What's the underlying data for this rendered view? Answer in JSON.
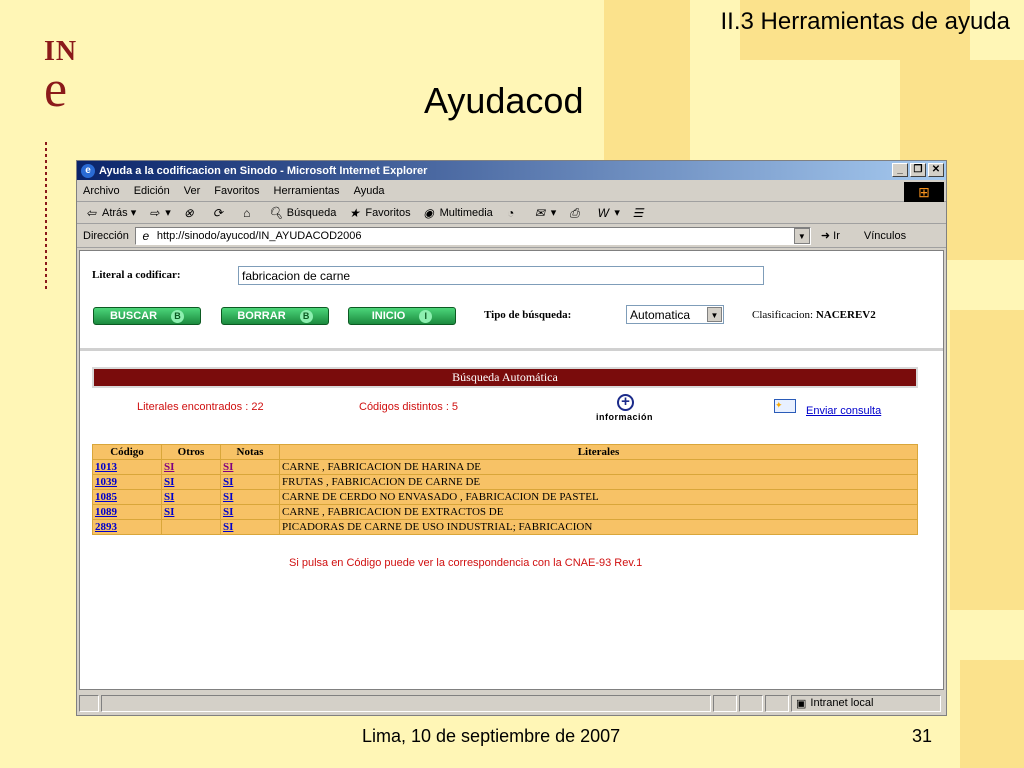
{
  "slide": {
    "header": "II.3 Herramientas de ayuda",
    "title": "Ayudacod",
    "footer_date": "Lima, 10 de septiembre de 2007",
    "page_number": "31",
    "logo_top": "IN",
    "logo_bottom": "e"
  },
  "browser": {
    "window_title": "Ayuda a la codificacion en Sinodo - Microsoft Internet Explorer",
    "menu": [
      "Archivo",
      "Edición",
      "Ver",
      "Favoritos",
      "Herramientas",
      "Ayuda"
    ],
    "toolbar": {
      "back": "Atrás",
      "search": "Búsqueda",
      "favorites": "Favoritos",
      "multimedia": "Multimedia"
    },
    "address_label": "Dirección",
    "address_url": "http://sinodo/ayucod/IN_AYUDACOD2006",
    "go_label": "Ir",
    "links_label": "Vínculos",
    "status_zone": "Intranet local"
  },
  "form": {
    "literal_label": "Literal a codificar:",
    "literal_value": "fabricacion de carne",
    "buttons": [
      {
        "label": "BUSCAR",
        "key": "B"
      },
      {
        "label": "BORRAR",
        "key": "B"
      },
      {
        "label": "INICIO",
        "key": "I"
      }
    ],
    "tipo_label": "Tipo de búsqueda:",
    "tipo_value": "Automatica",
    "clasificacion_label": "Clasificacion:",
    "clasificacion_value": "NACEREV2"
  },
  "results": {
    "bar_title": "Búsqueda Automática",
    "literales_encontrados": "Literales encontrados : 22",
    "codigos_distintos": "Códigos distintos : 5",
    "info_label": "información",
    "send_link": "Enviar consulta",
    "columns": [
      "Código",
      "Otros",
      "Notas",
      "Literales"
    ],
    "rows": [
      {
        "codigo": "1013",
        "otros": "SI",
        "notas": "SI",
        "literal": "CARNE , FABRICACION DE HARINA DE"
      },
      {
        "codigo": "1039",
        "otros": "SI",
        "notas": "SI",
        "literal": "FRUTAS , FABRICACION DE CARNE DE"
      },
      {
        "codigo": "1085",
        "otros": "SI",
        "notas": "SI",
        "literal": "CARNE DE CERDO NO ENVASADO , FABRICACION DE PASTEL"
      },
      {
        "codigo": "1089",
        "otros": "SI",
        "notas": "SI",
        "literal": "CARNE , FABRICACION DE EXTRACTOS DE"
      },
      {
        "codigo": "2893",
        "otros": "",
        "notas": "SI",
        "literal": "PICADORAS DE CARNE DE USO INDUSTRIAL; FABRICACION"
      }
    ],
    "hint": "Si pulsa en Código puede ver la correspondencia con la CNAE-93 Rev.1"
  }
}
